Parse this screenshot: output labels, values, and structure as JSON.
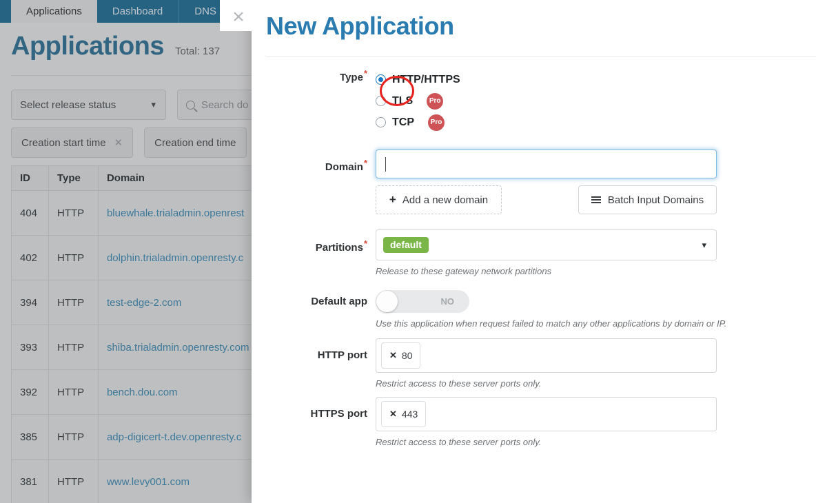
{
  "background": {
    "tabs": [
      {
        "label": "Applications",
        "active": true
      },
      {
        "label": "Dashboard",
        "active": false
      },
      {
        "label": "DNS",
        "active": false
      }
    ],
    "page_title": "Applications",
    "total_label": "Total: 137",
    "filters": {
      "release_status_placeholder": "Select release status",
      "search_placeholder": "Search do",
      "creation_start_time": "Creation start time",
      "creation_end_time": "Creation end time"
    },
    "table": {
      "columns": [
        "ID",
        "Type",
        "Domain"
      ],
      "rows": [
        {
          "id": "404",
          "type": "HTTP",
          "domain": "bluewhale.trialadmin.openrest"
        },
        {
          "id": "402",
          "type": "HTTP",
          "domain": "dolphin.trialadmin.openresty.c"
        },
        {
          "id": "394",
          "type": "HTTP",
          "domain": "test-edge-2.com"
        },
        {
          "id": "393",
          "type": "HTTP",
          "domain": "shiba.trialadmin.openresty.com"
        },
        {
          "id": "392",
          "type": "HTTP",
          "domain": "bench.dou.com"
        },
        {
          "id": "385",
          "type": "HTTP",
          "domain": "adp-digicert-t.dev.openresty.c"
        },
        {
          "id": "381",
          "type": "HTTP",
          "domain": "www.levy001.com"
        }
      ]
    }
  },
  "modal": {
    "title": "New Application",
    "close_icon": "×",
    "type": {
      "label": "Type",
      "required_mark": "*",
      "options": [
        {
          "label": "HTTP/HTTPS",
          "selected": true,
          "pro": false
        },
        {
          "label": "TLS",
          "selected": false,
          "pro": true,
          "pro_label": "Pro"
        },
        {
          "label": "TCP",
          "selected": false,
          "pro": true,
          "pro_label": "Pro"
        }
      ]
    },
    "domain": {
      "label": "Domain",
      "required_mark": "*",
      "value": "",
      "placeholder": "",
      "add_button": "Add a new domain",
      "add_icon": "+",
      "batch_button": "Batch Input Domains"
    },
    "partitions": {
      "label": "Partitions",
      "required_mark": "*",
      "selected_tag": "default",
      "hint": "Release to these gateway network partitions"
    },
    "default_app": {
      "label": "Default app",
      "toggle_state": "NO",
      "hint": "Use this application when request failed to match any other applications by domain or IP."
    },
    "http_port": {
      "label": "HTTP port",
      "tags": [
        "80"
      ],
      "remove_icon": "✕",
      "hint": "Restrict access to these server ports only."
    },
    "https_port": {
      "label": "HTTPS port",
      "tags": [
        "443"
      ],
      "remove_icon": "✕",
      "hint": "Restrict access to these server ports only."
    }
  },
  "colors": {
    "tabbar": "#1b6d96",
    "page_title": "#2a6f93",
    "modal_title": "#2a7bb0",
    "link": "#3b89b4",
    "pro_badge": "#cd5356",
    "tag_green": "#7ab547",
    "annotation_red": "#e8231f",
    "radio_selected": "#1577c4"
  }
}
